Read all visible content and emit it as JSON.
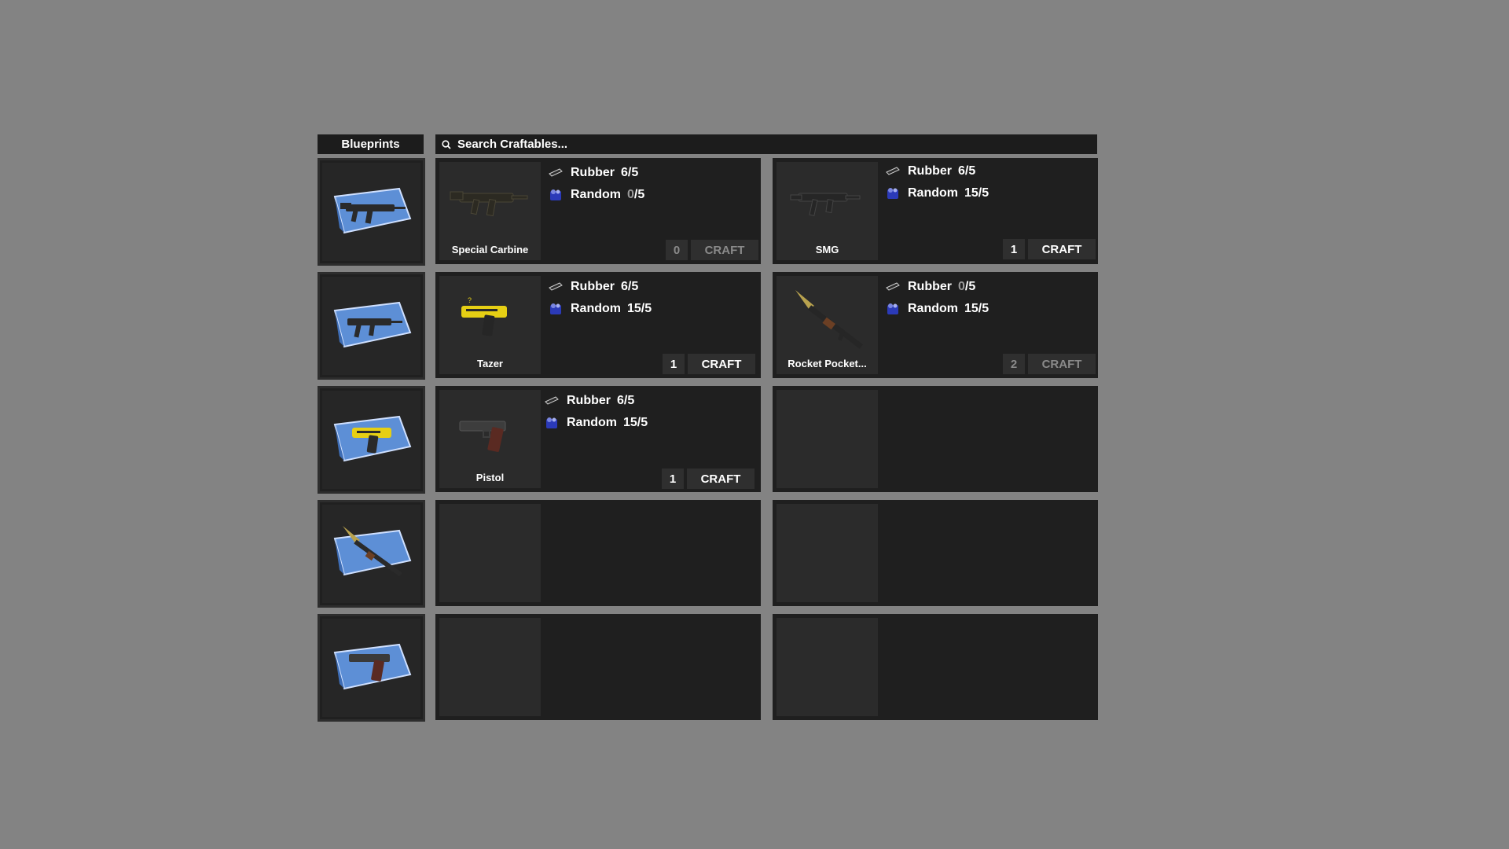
{
  "sidebar": {
    "title": "Blueprints",
    "slots": [
      {
        "icon": "carbine-blueprint-icon"
      },
      {
        "icon": "smg-blueprint-icon"
      },
      {
        "icon": "tazer-blueprint-icon"
      },
      {
        "icon": "rocket-blueprint-icon"
      },
      {
        "icon": "pistol-blueprint-icon"
      }
    ]
  },
  "search": {
    "placeholder": "Search Craftables..."
  },
  "craftables": [
    {
      "name": "Special Carbine",
      "icon": "carbine-icon",
      "reqs": [
        {
          "label": "Rubber",
          "have": "6",
          "need": "/5",
          "icon": "rubber-icon"
        },
        {
          "label": "Random",
          "have": "0",
          "need": "/5",
          "icon": "random-icon"
        }
      ],
      "count": "0",
      "craft_label": "CRAFT",
      "enabled": false
    },
    {
      "name": "SMG",
      "icon": "smg-icon",
      "reqs": [
        {
          "label": "Rubber",
          "have": "6",
          "need": "/5",
          "icon": "rubber-icon"
        },
        {
          "label": "Random",
          "have": "15",
          "need": "/5",
          "icon": "random-icon"
        }
      ],
      "count": "1",
      "craft_label": "CRAFT",
      "enabled": true
    },
    {
      "name": "Tazer",
      "icon": "tazer-icon",
      "reqs": [
        {
          "label": "Rubber",
          "have": "6",
          "need": "/5",
          "icon": "rubber-icon"
        },
        {
          "label": "Random",
          "have": "15",
          "need": "/5",
          "icon": "random-icon"
        }
      ],
      "count": "1",
      "craft_label": "CRAFT",
      "enabled": true
    },
    {
      "name": "Rocket Pocket...",
      "icon": "rocket-launcher-icon",
      "reqs": [
        {
          "label": "Rubber",
          "have": "0",
          "need": "/5",
          "icon": "rubber-icon"
        },
        {
          "label": "Random",
          "have": "15",
          "need": "/5",
          "icon": "random-icon"
        }
      ],
      "count": "2",
      "craft_label": "CRAFT",
      "enabled": false
    },
    {
      "name": "Pistol",
      "icon": "pistol-icon",
      "reqs": [
        {
          "label": "Rubber",
          "have": "6",
          "need": "/5",
          "icon": "rubber-icon"
        },
        {
          "label": "Random",
          "have": "15",
          "need": "/5",
          "icon": "random-icon"
        }
      ],
      "count": "1",
      "craft_label": "CRAFT",
      "enabled": true
    }
  ],
  "colors": {
    "background": "#838383",
    "panel": "#1f1f1f",
    "slot": "#2b2b2b",
    "button": "#2f2f2f",
    "blueprint": "#5d8fd6"
  }
}
